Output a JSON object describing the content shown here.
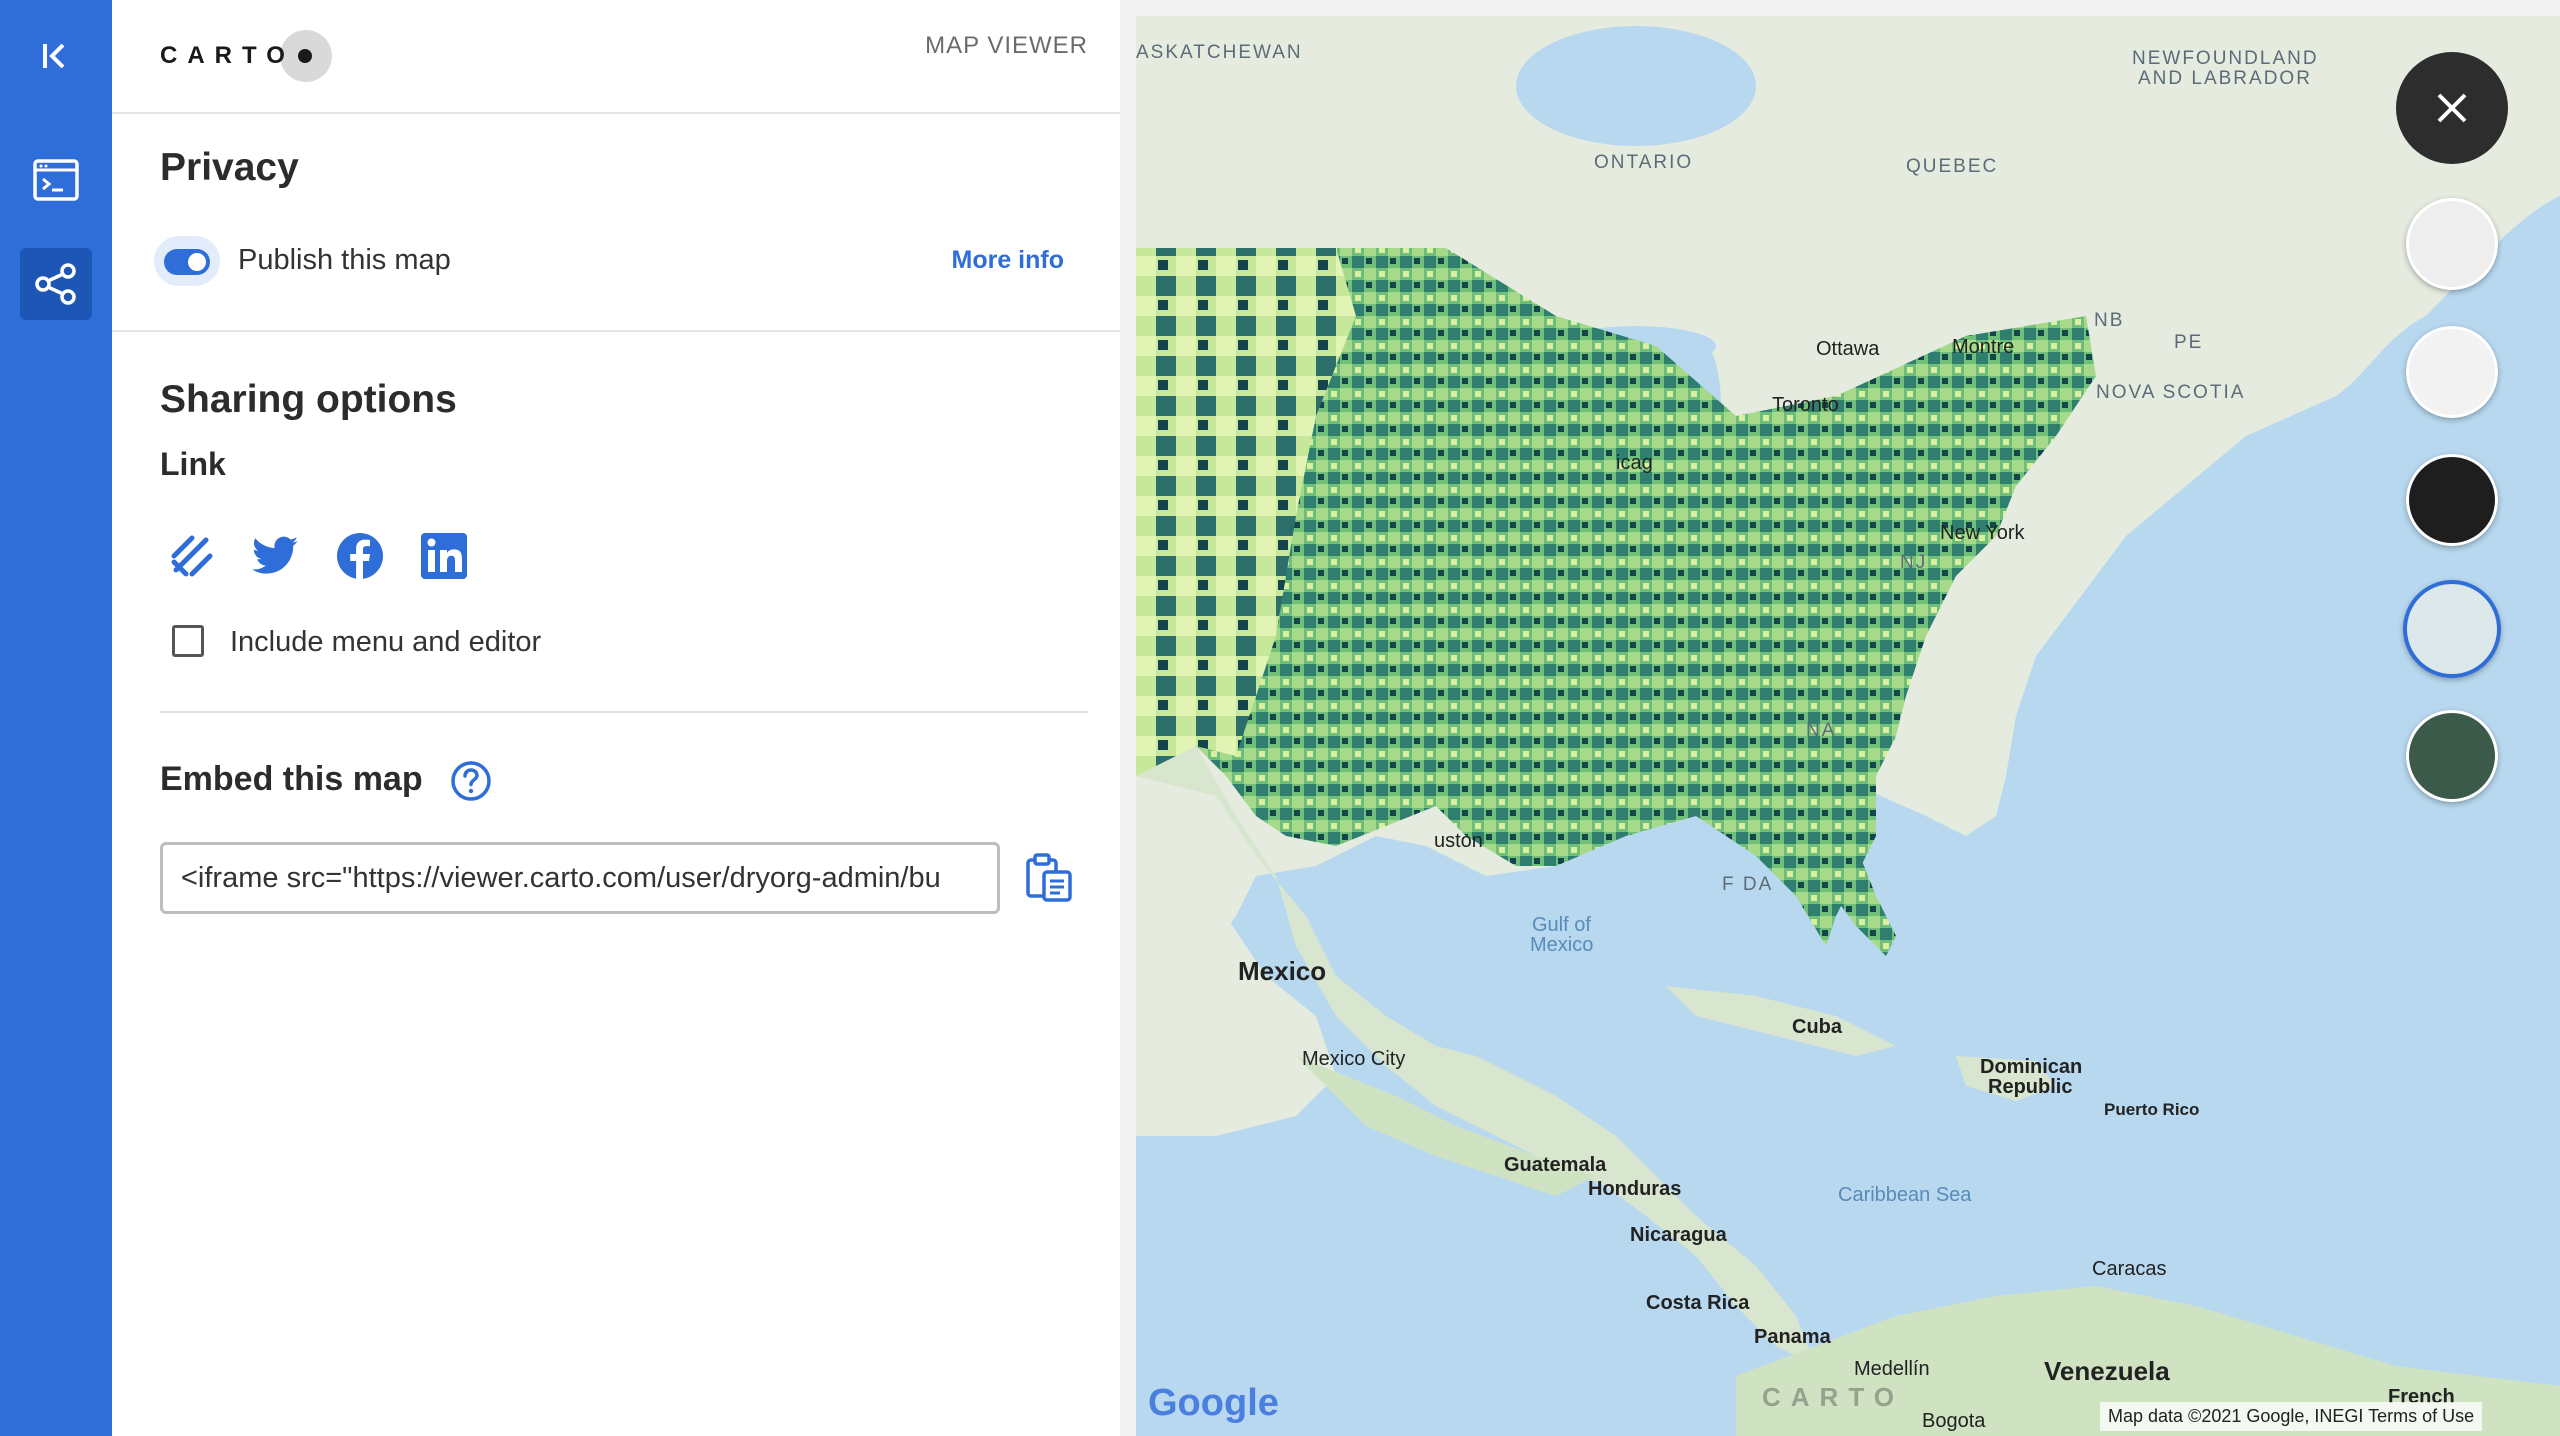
{
  "panel": {
    "logo": "CARTO",
    "header_label": "MAP VIEWER",
    "privacy": {
      "title": "Privacy",
      "publish_label": "Publish this map",
      "publish_enabled": true,
      "more_info": "More info"
    },
    "sharing": {
      "title": "Sharing options",
      "link_label": "Link",
      "share_icons": [
        "copy-link-icon",
        "twitter-icon",
        "facebook-icon",
        "linkedin-icon"
      ],
      "include_label": "Include menu and editor",
      "include_checked": false,
      "embed_title": "Embed this map",
      "embed_value": "<iframe src=\"https://viewer.carto.com/user/dryorg-admin/bu"
    }
  },
  "rail": {
    "items": [
      "collapse-icon",
      "code-panel-icon",
      "share-icon"
    ],
    "active": "share-icon"
  },
  "map": {
    "labels": {
      "saskatchewan": "ASKATCHEWAN",
      "ontario": "ONTARIO",
      "quebec": "QUEBEC",
      "newfoundland1": "NEWFOUNDLAND",
      "newfoundland2": "AND LABRADOR",
      "nb": "NB",
      "pe": "PE",
      "nova_scotia": "NOVA SCOTIA",
      "ottawa": "Ottawa",
      "montreal": "Montre",
      "toronto": "Toronto",
      "chicago": "icag",
      "new_york": "New York",
      "nj": "NJ",
      "na": "NA",
      "houston": "uston",
      "florida": "F      DA",
      "gulf1": "Gulf of",
      "gulf2": "Mexico",
      "mexico": "Mexico",
      "mexico_city": "Mexico City",
      "cuba": "Cuba",
      "dominican1": "Dominican",
      "dominican2": "Republic",
      "puerto_rico": "Puerto Rico",
      "guatemala": "Guatemala",
      "honduras": "Honduras",
      "nicaragua": "Nicaragua",
      "caribbean": "Caribbean Sea",
      "caracas": "Caracas",
      "costa_rica": "Costa Rica",
      "panama": "Panama",
      "medellin": "Medellín",
      "venezuela": "Venezuela",
      "bogota": "Bogota",
      "french": "French"
    },
    "google": "Google",
    "attribution": "Map data ©2021 Google, INEGI  Terms of Use",
    "watermark": "CARTO",
    "basemaps": [
      "positron",
      "voyager-light",
      "dark-matter",
      "voyager",
      "satellite"
    ],
    "selected_basemap": "voyager",
    "colors": {
      "land": "#e8efe3",
      "water": "#b8d8f0",
      "choropleth_light": "#d8f0a0",
      "choropleth_mid": "#6fbf7a",
      "choropleth_dark": "#14454f"
    }
  }
}
